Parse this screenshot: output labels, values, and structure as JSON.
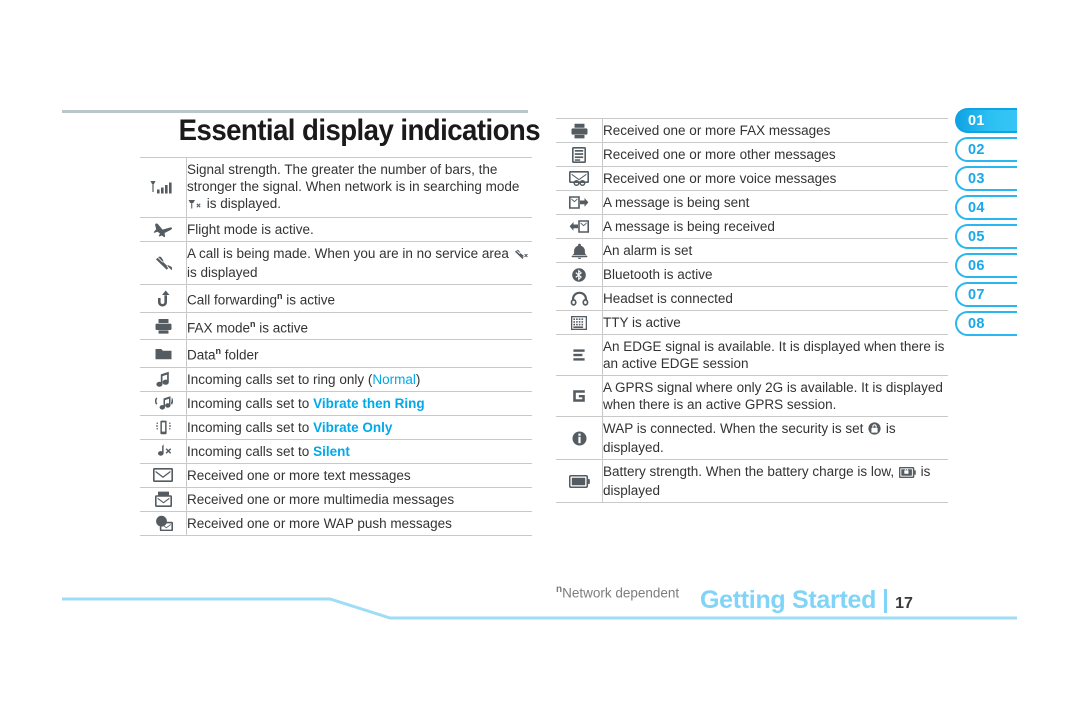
{
  "page": {
    "title": "Essential display indications",
    "footnote_marker": "n",
    "footnote_text": "Network dependent",
    "running_title": "Getting Started",
    "page_number": "17"
  },
  "colors": {
    "accent_blue": "#00a9e8",
    "tab_blue": "#2bb6ef",
    "footer_blue": "#7fd4f7",
    "rule_gray": "#c9c9c9",
    "icon_gray": "#555c61"
  },
  "tabs": [
    {
      "label": "01",
      "active": true
    },
    {
      "label": "02",
      "active": false
    },
    {
      "label": "03",
      "active": false
    },
    {
      "label": "04",
      "active": false
    },
    {
      "label": "05",
      "active": false
    },
    {
      "label": "06",
      "active": false
    },
    {
      "label": "07",
      "active": false
    },
    {
      "label": "08",
      "active": false
    }
  ],
  "left_column": [
    {
      "icon": "signal-strength-icon",
      "text_1": "Signal strength. The greater the number of bars, the stronger the signal. When network is in searching mode ",
      "inline_icon": "signal-searching-icon",
      "text_2": " is displayed."
    },
    {
      "icon": "flight-mode-icon",
      "text_1": "Flight mode is active."
    },
    {
      "icon": "call-in-progress-icon",
      "text_1": "A call is being made. When you are in no service area ",
      "inline_icon": "no-service-call-icon",
      "text_2": " is displayed"
    },
    {
      "icon": "call-forwarding-icon",
      "text_1": "Call forwarding",
      "superscript": "n",
      "text_2": " is active"
    },
    {
      "icon": "fax-mode-icon",
      "text_1": "FAX mode",
      "superscript": "n",
      "text_2": " is active"
    },
    {
      "icon": "data-folder-icon",
      "text_1": "Data",
      "superscript": "n",
      "text_2": " folder"
    },
    {
      "icon": "ring-only-icon",
      "text_1": "Incoming calls set to ring only (",
      "highlight": "Normal",
      "highlight_style": "plain",
      "text_2": ")"
    },
    {
      "icon": "vibrate-then-ring-icon",
      "text_1": "Incoming calls set to ",
      "highlight": "Vibrate then Ring",
      "highlight_style": "bold"
    },
    {
      "icon": "vibrate-only-icon",
      "text_1": "Incoming calls set to ",
      "highlight": "Vibrate Only",
      "highlight_style": "bold"
    },
    {
      "icon": "silent-icon",
      "text_1": "Incoming calls set to ",
      "highlight": "Silent",
      "highlight_style": "bold"
    },
    {
      "icon": "text-message-icon",
      "text_1": "Received one or more text messages"
    },
    {
      "icon": "multimedia-message-icon",
      "text_1": "Received one or more multimedia messages"
    },
    {
      "icon": "wap-push-message-icon",
      "text_1": "Received one or more WAP push messages"
    }
  ],
  "right_column": [
    {
      "icon": "fax-message-icon",
      "text_1": "Received one or more FAX messages"
    },
    {
      "icon": "other-message-icon",
      "text_1": "Received one or more other messages"
    },
    {
      "icon": "voice-message-icon",
      "text_1": "Received one or more voice messages"
    },
    {
      "icon": "message-sending-icon",
      "text_1": "A message is being sent"
    },
    {
      "icon": "message-receiving-icon",
      "text_1": "A message is being received"
    },
    {
      "icon": "alarm-icon",
      "text_1": "An alarm is set"
    },
    {
      "icon": "bluetooth-icon",
      "text_1": "Bluetooth is active"
    },
    {
      "icon": "headset-icon",
      "text_1": "Headset is connected"
    },
    {
      "icon": "tty-icon",
      "text_1": "TTY is active"
    },
    {
      "icon": "edge-icon",
      "text_1": "An EDGE signal is available. It is displayed when there is an active EDGE session"
    },
    {
      "icon": "gprs-icon",
      "text_1": "A GPRS signal where only 2G is available. It is displayed when there is an active GPRS session."
    },
    {
      "icon": "wap-connected-icon",
      "text_1": "WAP is connected. When the security is set ",
      "inline_icon": "wap-security-lock-icon",
      "text_2": " is displayed."
    },
    {
      "icon": "battery-icon",
      "text_1": "Battery strength. When the battery charge is low, ",
      "inline_icon": "battery-low-icon",
      "text_2": " is displayed"
    }
  ]
}
